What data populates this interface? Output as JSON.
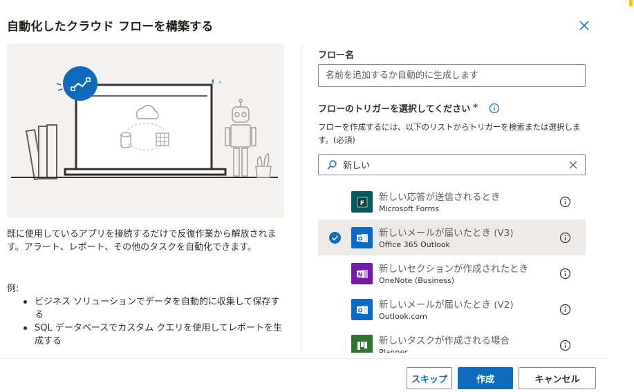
{
  "dialog": {
    "title": "自動化したクラウド フローを構築する"
  },
  "left": {
    "description": "既に使用しているアプリを接続するだけで反復作業から解放されます。アラート、レポート、その他のタスクを自動化できます。",
    "example_label": "例:",
    "examples": [
      "ビジネス ソリューションでデータを自動的に収集して保存する",
      "SQL データベースでカスタム クエリを使用してレポートを生成する"
    ]
  },
  "form": {
    "flow_name_label": "フロー名",
    "flow_name_placeholder": "名前を追加するか自動的に生成します",
    "trigger_label": "フローのトリガーを選択してください",
    "required_mark": "*",
    "trigger_help": "フローを作成するには、以下のリストからトリガーを検索または選択します。(必須)",
    "search_value": "新しい"
  },
  "triggers": [
    {
      "title": "新しい応答が送信されるとき",
      "connector": "Microsoft Forms",
      "icon": "forms-icon",
      "color": "#035a5c",
      "selected": false
    },
    {
      "title": "新しいメールが届いたとき (V3)",
      "connector": "Office 365 Outlook",
      "icon": "outlook-icon",
      "color": "#0a6cc8",
      "selected": true
    },
    {
      "title": "新しいセクションが作成されたとき",
      "connector": "OneNote (Business)",
      "icon": "onenote-icon",
      "color": "#7719aa",
      "selected": false
    },
    {
      "title": "新しいメールが届いたとき (V2)",
      "connector": "Outlook.com",
      "icon": "outlook-icon",
      "color": "#0a6cc8",
      "selected": false
    },
    {
      "title": "新しいタスクが作成される場合",
      "connector": "Planner",
      "icon": "planner-icon",
      "color": "#31752f",
      "selected": false
    }
  ],
  "buttons": {
    "skip": "スキップ",
    "create": "作成",
    "cancel": "キャンセル"
  },
  "colors": {
    "accent": "#0f6cbd",
    "selected_row": "#edebe9",
    "required": "#a4262c"
  }
}
